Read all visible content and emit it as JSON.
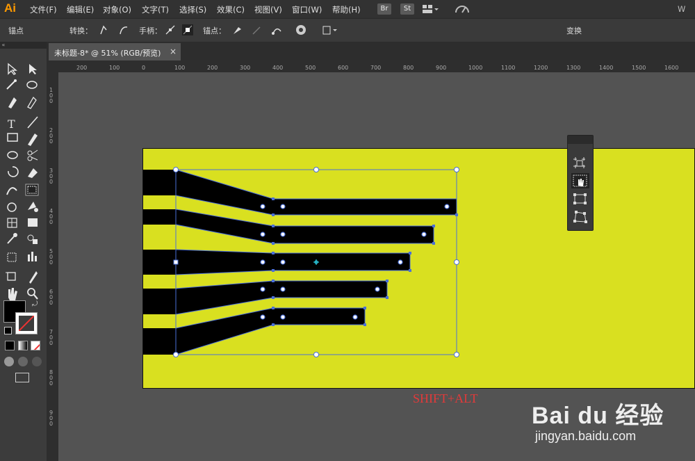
{
  "app": {
    "logo": "Ai",
    "right_clip": "W"
  },
  "menu": [
    {
      "label": "文件(F)",
      "name": "menu-file"
    },
    {
      "label": "编辑(E)",
      "name": "menu-edit"
    },
    {
      "label": "对象(O)",
      "name": "menu-object"
    },
    {
      "label": "文字(T)",
      "name": "menu-type"
    },
    {
      "label": "选择(S)",
      "name": "menu-select"
    },
    {
      "label": "效果(C)",
      "name": "menu-effect"
    },
    {
      "label": "视图(V)",
      "name": "menu-view"
    },
    {
      "label": "窗口(W)",
      "name": "menu-window"
    },
    {
      "label": "帮助(H)",
      "name": "menu-help"
    }
  ],
  "menubar_buttons": {
    "bridge": "Br",
    "stock": "St"
  },
  "control": {
    "anchor_label": "锚点",
    "convert_label": "转换：",
    "handle_label": "手柄：",
    "anchor_point_label": "锚点：",
    "transform_label": "变换"
  },
  "document": {
    "tab_title": "未标题-8* @ 51% (RGB/预览)",
    "close": "×"
  },
  "ruler": {
    "h_labels": [
      "200",
      "100",
      "0",
      "100",
      "200",
      "300",
      "400",
      "500",
      "600",
      "700",
      "800",
      "900",
      "1000",
      "1100",
      "1200",
      "1300",
      "1400",
      "1500",
      "1600"
    ],
    "v_labels": [
      "100",
      "200",
      "300",
      "400",
      "500",
      "600",
      "700",
      "800",
      "900"
    ]
  },
  "canvas": {
    "hint_text": "SHIFT+ALT",
    "artboard_color": "#d9e020",
    "shape_color": "#000000",
    "selection_color": "#4a6fd8"
  },
  "watermark": {
    "brand": "Bai du 经验",
    "url": "jingyan.baidu.com"
  },
  "floating_panel": {
    "tools": [
      "isolate-icon",
      "hand-select-icon",
      "transform-free-icon",
      "perspective-icon"
    ]
  }
}
